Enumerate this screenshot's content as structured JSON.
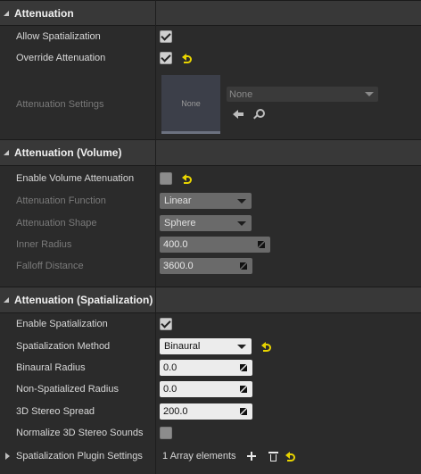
{
  "sections": {
    "attenuation": {
      "title": "Attenuation",
      "allow_spatialization": {
        "label": "Allow Spatialization",
        "checked": true
      },
      "override_attenuation": {
        "label": "Override Attenuation",
        "checked": true
      },
      "attenuation_settings": {
        "label": "Attenuation Settings",
        "thumbnail_text": "None",
        "asset_value": "None"
      }
    },
    "volume": {
      "title": "Attenuation (Volume)",
      "enable_volume_attenuation": {
        "label": "Enable Volume Attenuation",
        "checked": false
      },
      "attenuation_function": {
        "label": "Attenuation Function",
        "value": "Linear"
      },
      "attenuation_shape": {
        "label": "Attenuation Shape",
        "value": "Sphere"
      },
      "inner_radius": {
        "label": "Inner Radius",
        "value": "400.0"
      },
      "falloff_distance": {
        "label": "Falloff Distance",
        "value": "3600.0"
      }
    },
    "spatialization": {
      "title": "Attenuation (Spatialization)",
      "enable_spatialization": {
        "label": "Enable Spatialization",
        "checked": true
      },
      "spatialization_method": {
        "label": "Spatialization Method",
        "value": "Binaural"
      },
      "binaural_radius": {
        "label": "Binaural Radius",
        "value": "0.0"
      },
      "non_spatialized_radius": {
        "label": "Non-Spatialized Radius",
        "value": "0.0"
      },
      "stereo_spread": {
        "label": "3D Stereo Spread",
        "value": "200.0"
      },
      "normalize_stereo": {
        "label": "Normalize 3D Stereo Sounds",
        "checked": false
      },
      "plugin_settings": {
        "label": "Spatialization Plugin Settings",
        "value": "1 Array elements"
      }
    }
  },
  "icons": {
    "reset": "reset-to-default-icon",
    "use_selected": "use-selected-asset-icon",
    "browse": "browse-asset-icon",
    "add": "plus-icon",
    "delete": "trash-icon"
  },
  "colors": {
    "panel_bg": "#2b2b2b",
    "header_bg": "#383838",
    "reset_arrow": "#e8d400"
  }
}
